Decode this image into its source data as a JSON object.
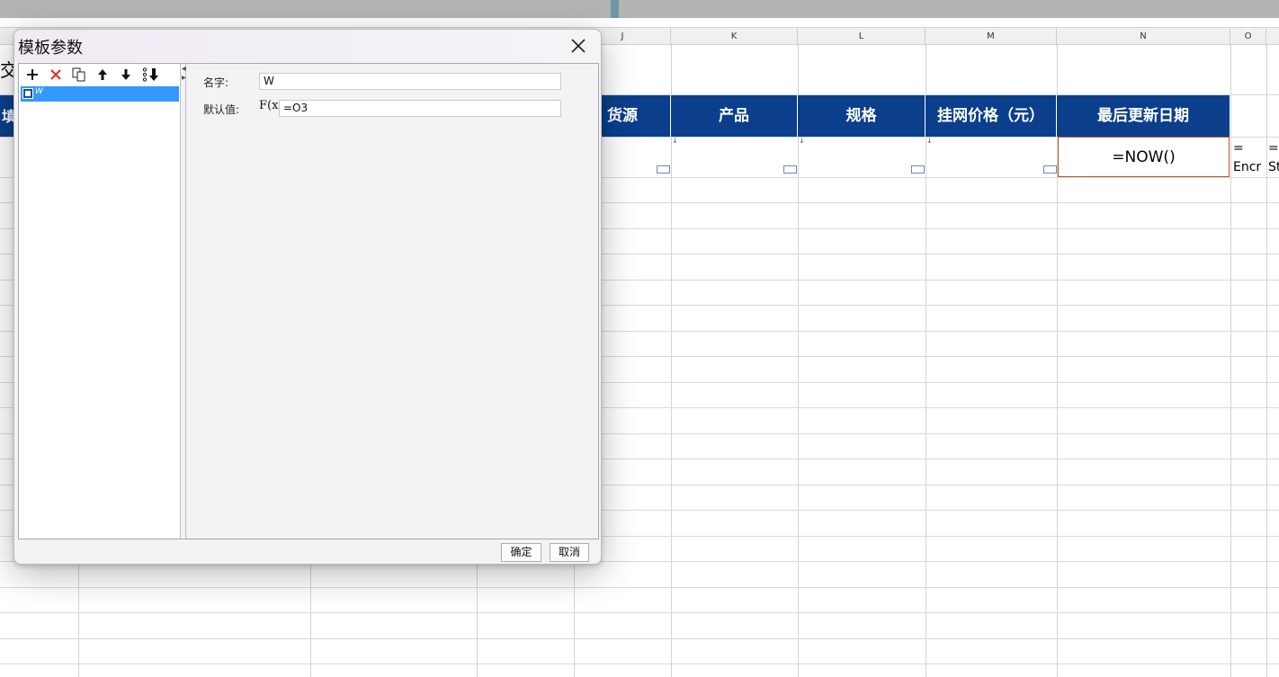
{
  "spreadsheet": {
    "columns": [
      {
        "id": "J",
        "label": "J"
      },
      {
        "id": "K",
        "label": "K"
      },
      {
        "id": "L",
        "label": "L"
      },
      {
        "id": "M",
        "label": "M"
      },
      {
        "id": "N",
        "label": "N"
      },
      {
        "id": "O",
        "label": "O"
      }
    ],
    "header_cells": {
      "j": "货源",
      "k": "产品",
      "l": "规格",
      "m": "挂网价格（元）",
      "n": "最后更新日期"
    },
    "formula_cell": "=NOW()",
    "spill_o_line1": "=",
    "spill_o_line2": "Encr",
    "spill_p_line1": "=I",
    "spill_p_line2": "St",
    "left_cut_title": "交",
    "left_cut_header": "填"
  },
  "dialog": {
    "title": "模板参数",
    "close_icon": "close-icon",
    "toolbar": {
      "add": "plus-icon",
      "delete": "delete-x-icon",
      "copy": "copy-icon",
      "move_up": "arrow-up-icon",
      "move_down": "arrow-down-icon",
      "sort": "sort-icon"
    },
    "tree_item_label": "W",
    "name_label": "名字:",
    "name_value": "W",
    "default_label": "默认值:",
    "default_value": "=O3",
    "fx_label": "F(x)",
    "ok_button": "确定",
    "cancel_button": "取消"
  },
  "colors": {
    "header_fill": "#0b3f8c",
    "selection": "#3399ff",
    "formula_border": "#b05a2a"
  }
}
